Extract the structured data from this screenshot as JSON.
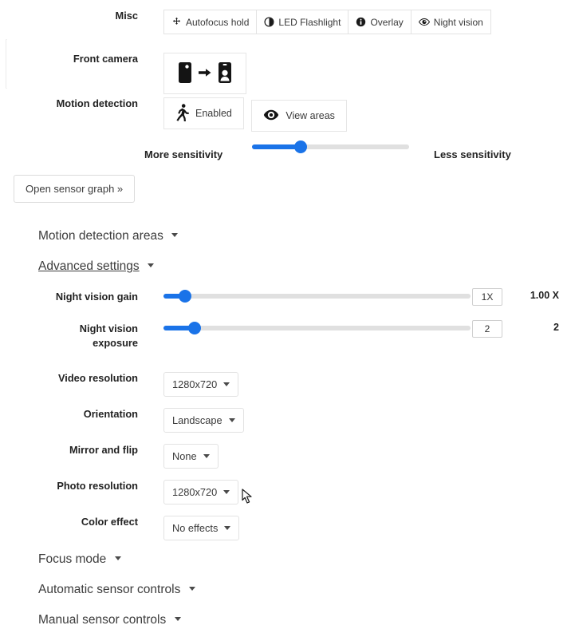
{
  "misc": {
    "label": "Misc",
    "buttons": [
      {
        "label": "Autofocus hold",
        "icon": "autofocus-icon"
      },
      {
        "label": "LED Flashlight",
        "icon": "flashlight-contrast-icon"
      },
      {
        "label": "Overlay",
        "icon": "info-circle-icon"
      },
      {
        "label": "Night vision",
        "icon": "eye-icon"
      }
    ]
  },
  "front_camera": {
    "label": "Front camera",
    "icon_from": "phone-rear-icon",
    "icon_arrow": "arrow-right-icon",
    "icon_to": "phone-front-camera-icon"
  },
  "motion_detection": {
    "label": "Motion detection",
    "enabled_button": {
      "label": "Enabled",
      "icon": "running-person-icon"
    },
    "view_areas_button": {
      "label": "View areas",
      "icon": "eye-target-icon"
    },
    "sensitivity": {
      "left_label": "More sensitivity",
      "right_label": "Less sensitivity",
      "percent": 31
    }
  },
  "sensor_graph_button": {
    "label": "Open sensor graph »"
  },
  "collapsibles": {
    "motion_detection_areas": "Motion detection areas",
    "advanced_settings": "Advanced settings",
    "focus_mode": "Focus mode",
    "automatic_sensor_controls": "Automatic sensor controls",
    "manual_sensor_controls": "Manual sensor controls"
  },
  "advanced": {
    "night_vision_gain": {
      "label": "Night vision gain",
      "input_value": "1X",
      "display_value": "1.00 X",
      "percent": 7
    },
    "night_vision_exposure": {
      "label_line1": "Night vision",
      "label_line2": "exposure",
      "input_value": "2",
      "display_value": "2",
      "percent": 10
    },
    "video_resolution": {
      "label": "Video resolution",
      "value": "1280x720"
    },
    "orientation": {
      "label": "Orientation",
      "value": "Landscape"
    },
    "mirror_and_flip": {
      "label": "Mirror and flip",
      "value": "None"
    },
    "photo_resolution": {
      "label": "Photo resolution",
      "value": "1280x720"
    },
    "color_effect": {
      "label": "Color effect",
      "value": "No effects"
    }
  },
  "colors": {
    "accent": "#1a73e8",
    "track": "#e0e0e0",
    "text": "#222222",
    "border": "#e3e3e3"
  }
}
